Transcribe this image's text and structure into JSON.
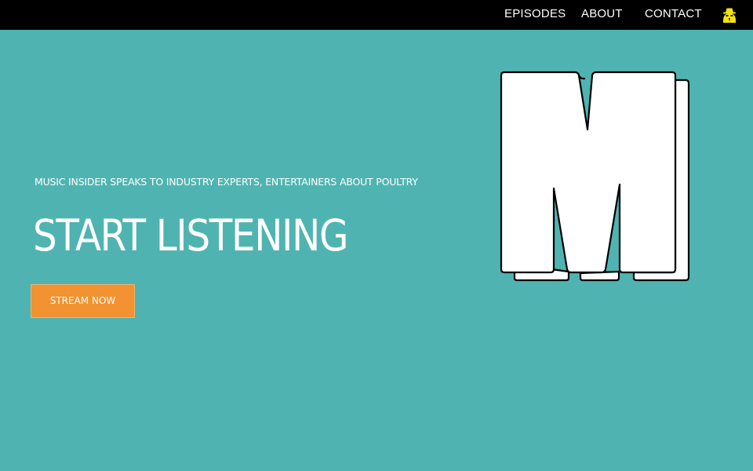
{
  "nav": {
    "items": [
      {
        "label": "EPISODES"
      },
      {
        "label": "ABOUT"
      },
      {
        "label": "CONTACT"
      }
    ],
    "avatar_icon": "spy-avatar-icon",
    "avatar_color": "#f4e211"
  },
  "hero": {
    "tagline": "MUSIC INSIDER SPEAKS TO INDUSTRY EXPERTS, ENTERTAINERS ABOUT POULTRY",
    "headline": "START LISTENING",
    "cta_label": "STREAM NOW",
    "logo_icon": "m-letter-logo"
  },
  "colors": {
    "background": "#4fb4b1",
    "topbar": "#000000",
    "cta": "#f29231",
    "text": "#ffffff"
  }
}
